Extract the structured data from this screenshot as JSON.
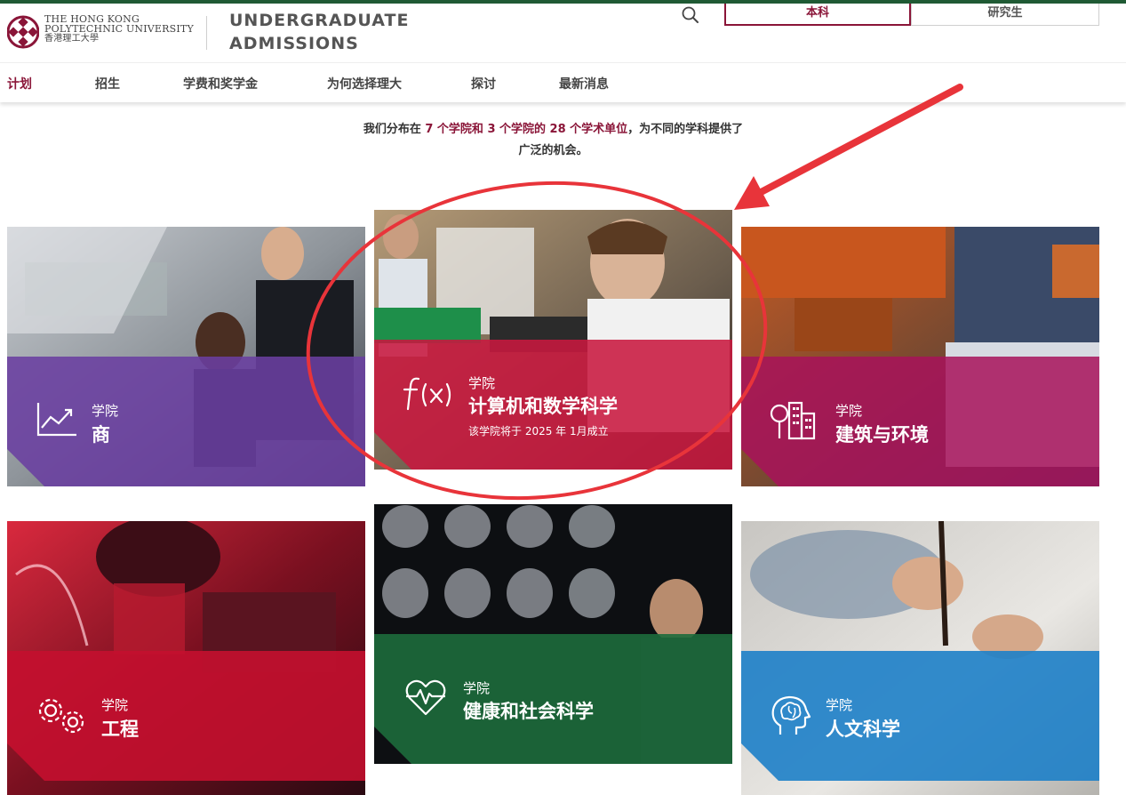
{
  "header": {
    "university_en_1": "The Hong Kong",
    "university_en_2": "Polytechnic University",
    "university_zh": "香港理工大學",
    "site_title_1": "UNDERGRADUATE",
    "site_title_2": "ADMISSIONS",
    "search_icon": "search-icon",
    "toggle_undergrad": "本科",
    "toggle_postgrad": "研究生"
  },
  "nav": {
    "items": [
      {
        "label": "计划"
      },
      {
        "label": "招生"
      },
      {
        "label": "学费和奖学金"
      },
      {
        "label": "为何选择理大"
      },
      {
        "label": "探讨"
      },
      {
        "label": "最新消息"
      }
    ]
  },
  "intro": {
    "part1": "我们分布在 ",
    "hl": "7 个学院和 3 个学院的 28 个学术单位",
    "part2": "，为不同的学科提供了",
    "line2": "广泛的机会。"
  },
  "faculties": [
    {
      "pre": "学院",
      "name": "商",
      "icon": "chart-icon",
      "color": "#6a3fa0"
    },
    {
      "pre": "学院",
      "name": "计算机和数学科学",
      "note": "该学院将于 2025 年 1月成立",
      "icon": "function-icon",
      "color": "#c8183f"
    },
    {
      "pre": "学院",
      "name": "建筑与环境",
      "icon": "buildings-icon",
      "color": "#a8125a"
    },
    {
      "pre": "学院",
      "name": "工程",
      "icon": "gears-icon",
      "color": "#c4102f"
    },
    {
      "pre": "学院",
      "name": "健康和社会科学",
      "icon": "heart-pulse-icon",
      "color": "#1d6b3c"
    },
    {
      "pre": "学院",
      "name": "人文科学",
      "icon": "head-brain-icon",
      "color": "#1d7fc8"
    }
  ],
  "colors": {
    "brand": "#8a1538",
    "topline": "#1f5a34",
    "annotation": "#e8343a"
  }
}
